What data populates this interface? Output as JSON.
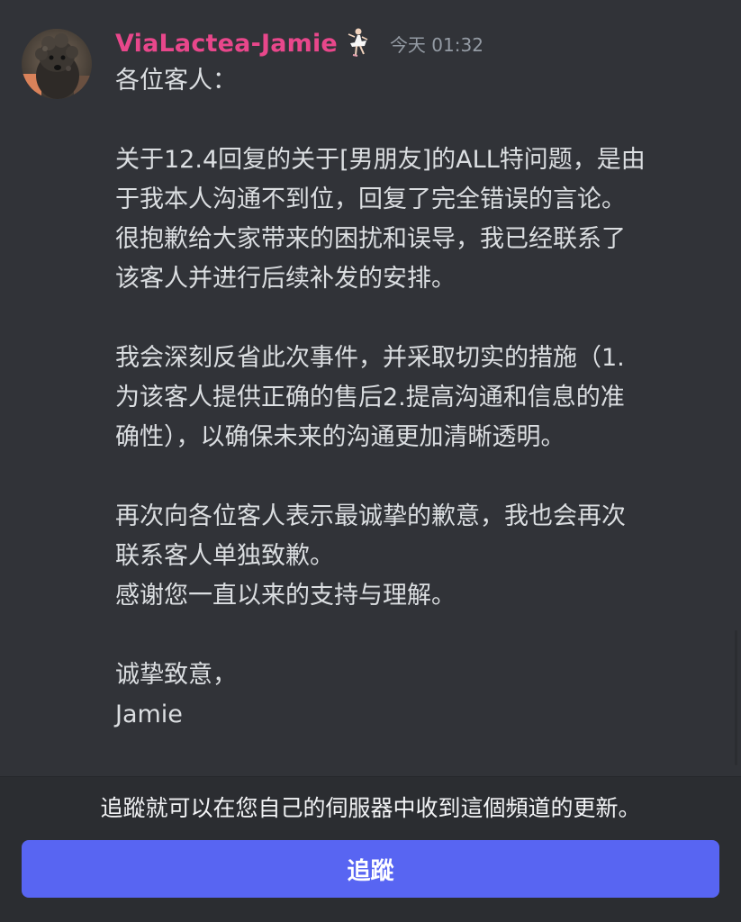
{
  "message": {
    "author": "ViaLactea-Jamie",
    "timestamp": "今天 01:32",
    "author_color": "#e8478b",
    "avatar_icon": "dog-avatar",
    "badge_icon": "dancer-badge-icon",
    "lines": [
      "各位客人：",
      "",
      "关于12.4回复的关于[男朋友]的ALL特问题，是由",
      "于我本人沟通不到位，回复了完全错误的言论。",
      "很抱歉给大家带来的困扰和误导，我已经联系了",
      "该客人并进行后续补发的安排。",
      "",
      "我会深刻反省此次事件，并采取切实的措施（1.",
      "为该客人提供正确的售后2.提高沟通和信息的准",
      "确性），以确保未来的沟通更加清晰透明。",
      "",
      "再次向各位客人表示最诚挚的歉意，我也会再次",
      "联系客人单独致歉。",
      "感谢您一直以来的支持与理解。",
      "",
      "诚挚致意，",
      "Jamie"
    ]
  },
  "footer": {
    "notice": "追蹤就可以在您自己的伺服器中收到這個頻道的更新。",
    "follow_label": "追蹤",
    "button_color": "#5865f2"
  }
}
